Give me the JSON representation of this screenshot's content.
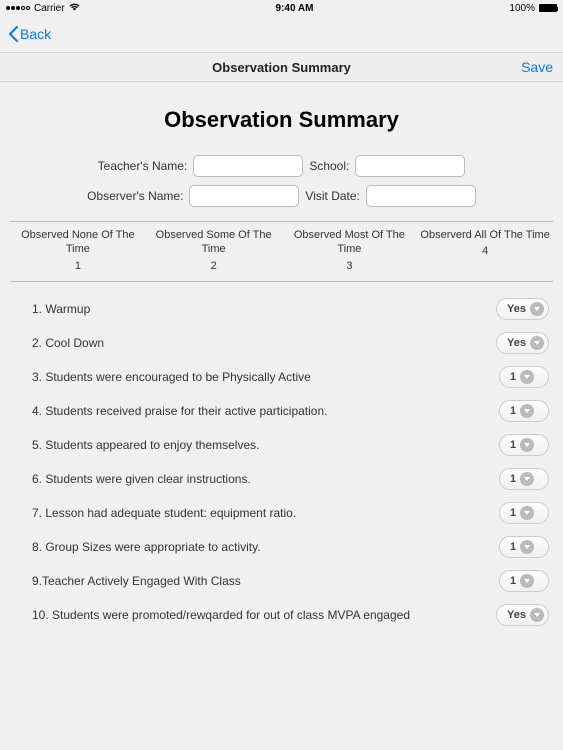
{
  "status": {
    "carrier": "Carrier",
    "time": "9:40 AM",
    "battery": "100%"
  },
  "nav": {
    "back": "Back"
  },
  "titleBar": {
    "title": "Observation Summary",
    "save": "Save"
  },
  "heading": "Observation Summary",
  "fields": {
    "teacherLabel": "Teacher's Name:",
    "teacherValue": "",
    "schoolLabel": "School:",
    "schoolValue": "",
    "observerLabel": "Observer's Name:",
    "observerValue": "",
    "visitLabel": "Visit Date:",
    "visitValue": ""
  },
  "scale": {
    "col1": {
      "label": "Observed None Of The Time",
      "num": "1"
    },
    "col2": {
      "label": "Observed Some Of The Time",
      "num": "2"
    },
    "col3": {
      "label": "Observed Most Of The Time",
      "num": "3"
    },
    "col4": {
      "label": "Observerd All Of The Time",
      "num": "4"
    }
  },
  "items": [
    {
      "text": "1. Warmup",
      "value": "Yes"
    },
    {
      "text": "2. Cool Down",
      "value": "Yes"
    },
    {
      "text": "3. Students were encouraged to be Physically Active",
      "value": "1"
    },
    {
      "text": "4. Students received praise for their active participation.",
      "value": "1"
    },
    {
      "text": "5. Students appeared to enjoy themselves.",
      "value": "1"
    },
    {
      "text": "6. Students were given clear instructions.",
      "value": "1"
    },
    {
      "text": "7. Lesson had adequate student: equipment ratio.",
      "value": "1"
    },
    {
      "text": "8. Group Sizes were appropriate to activity.",
      "value": "1"
    },
    {
      "text": "9.Teacher Actively Engaged With Class",
      "value": "1"
    },
    {
      "text": "10. Students were promoted/rewqarded for out of class MVPA engaged",
      "value": "Yes"
    }
  ]
}
